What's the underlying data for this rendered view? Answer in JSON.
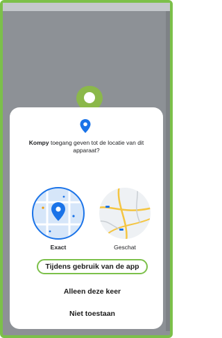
{
  "dialog": {
    "app_name": "Kompy",
    "prompt_rest": " toegang geven tot de locatie van dit apparaat?",
    "options": {
      "exact_label": "Exact",
      "approx_label": "Geschat"
    },
    "buttons": {
      "while_using": "Tijdens gebruik van de app",
      "only_once": "Alleen deze keer",
      "deny": "Niet toestaan"
    }
  },
  "colors": {
    "accent_green": "#7cc04a",
    "primary_blue": "#1a73e8",
    "scrim_gray": "#8d9196"
  },
  "icons": [
    "location-pin-icon",
    "map-exact-icon",
    "map-approx-icon"
  ]
}
